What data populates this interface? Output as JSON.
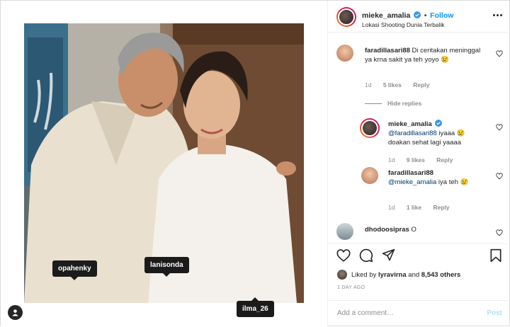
{
  "post": {
    "username": "mieke_amalia",
    "follow_label": "Follow",
    "dot": "•",
    "location": "Lokasi Shooting Dunia Terbalik"
  },
  "media": {
    "tags": [
      {
        "label": "opahenky"
      },
      {
        "label": "lanisonda"
      },
      {
        "label": "ilma_26"
      }
    ]
  },
  "comments": [
    {
      "user": "faradillasari88",
      "text": "Di ceritakan meninggal ya krna sakit ya teh yoyo",
      "emoji": "😢",
      "time": "1d",
      "likes": "5 likes",
      "reply": "Reply"
    },
    {
      "hide_replies": "Hide replies"
    },
    {
      "user": "mieke_amalia",
      "mention": "@faradillasari88",
      "text": "iyaaa",
      "emoji": "😢",
      "text2": "doakan sehat lagi yaaaa",
      "time": "1d",
      "likes": "9 likes",
      "reply": "Reply"
    },
    {
      "user": "faradillasari88",
      "mention": "@mieke_amalia",
      "text": "iya teh",
      "emoji": "😢",
      "time": "1d",
      "likes": "1 like",
      "reply": "Reply"
    },
    {
      "user": "dhodoosipras",
      "text": "O"
    }
  ],
  "likes": {
    "prefix": "Liked by",
    "user": "lyravirna",
    "middle": "and",
    "count": "8,543 others"
  },
  "time_ago": "1 DAY AGO",
  "add_comment": {
    "placeholder": "Add a comment…",
    "post_label": "Post"
  },
  "colors": {
    "accent": "#0095f6",
    "verified": "#3897f0",
    "muted": "#8e8e8e"
  },
  "icons": [
    "heart-icon",
    "comment-icon",
    "share-icon",
    "bookmark-icon",
    "more-icon",
    "verified-icon",
    "user-tag-icon"
  ]
}
